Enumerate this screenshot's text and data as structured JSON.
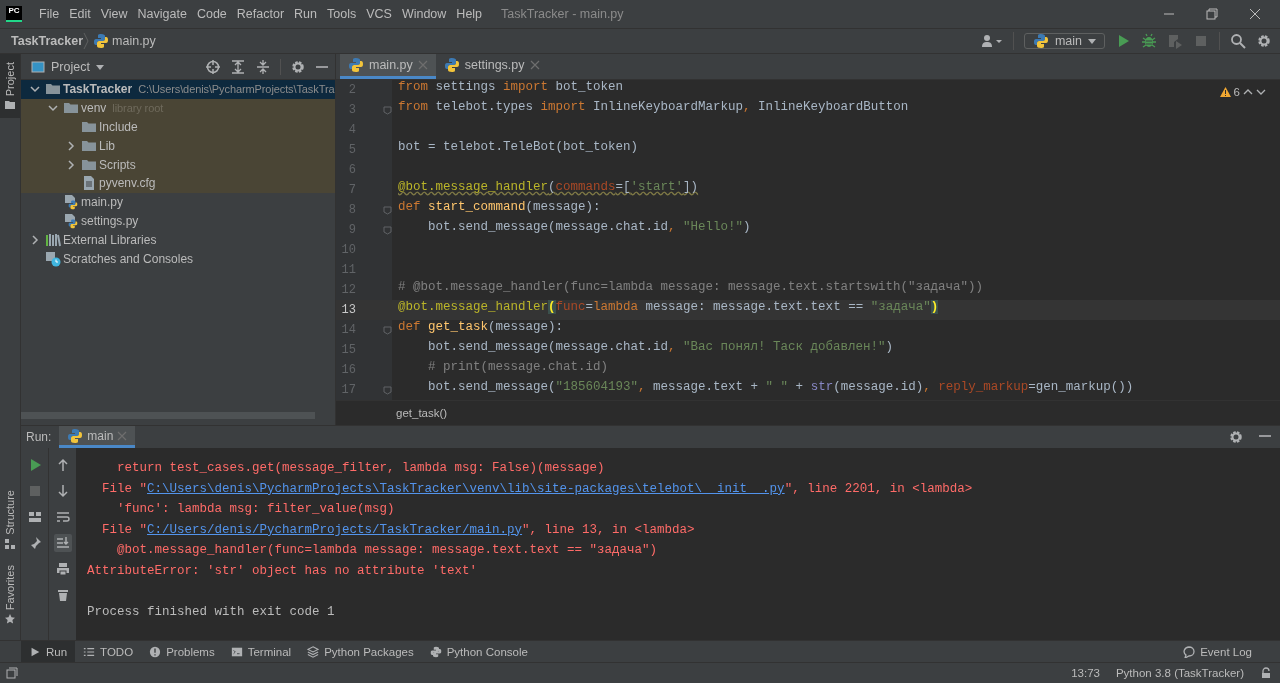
{
  "title_bar": {
    "logo": "PC",
    "menu": [
      "File",
      "Edit",
      "View",
      "Navigate",
      "Code",
      "Refactor",
      "Run",
      "Tools",
      "VCS",
      "Window",
      "Help"
    ],
    "title": "TaskTracker - main.py"
  },
  "navigation_bar": {
    "breadcrumbs": [
      "TaskTracker",
      "main.py"
    ],
    "run_configuration": "main"
  },
  "left_stripe": {
    "top_tabs": [
      {
        "label": "Project",
        "selected": true
      }
    ],
    "bottom_tabs": [
      {
        "label": "Structure",
        "selected": false
      },
      {
        "label": "Favorites",
        "selected": false
      }
    ]
  },
  "project_panel": {
    "title": "Project",
    "tree": [
      {
        "kind": "folder",
        "name": "TaskTracker",
        "hint": "C:\\Users\\denis\\PycharmProjects\\TaskTra",
        "expanded": true,
        "selected": true,
        "children": [
          {
            "kind": "folder",
            "name": "venv",
            "hint": "library root",
            "expanded": true,
            "selected": false,
            "library_root": true,
            "children": [
              {
                "kind": "folder",
                "name": "Include",
                "selected": false
              },
              {
                "kind": "folder",
                "name": "Lib",
                "expanded": false,
                "selected": false
              },
              {
                "kind": "folder",
                "name": "Scripts",
                "expanded": false,
                "selected": false
              },
              {
                "kind": "config",
                "name": "pyvenv.cfg",
                "selected": false
              }
            ]
          },
          {
            "kind": "python",
            "name": "main.py",
            "selected": false
          },
          {
            "kind": "python",
            "name": "settings.py",
            "selected": false
          }
        ]
      },
      {
        "kind": "libraries",
        "name": "External Libraries",
        "expanded": false,
        "selected": false
      },
      {
        "kind": "scratches",
        "name": "Scratches and Consoles",
        "selected": false
      }
    ]
  },
  "editor": {
    "tabs": [
      {
        "label": "main.py",
        "selected": true
      },
      {
        "label": "settings.py",
        "selected": false
      }
    ],
    "warnings": "6",
    "breadcrumb": "get_task()",
    "lines": [
      {
        "number": "2",
        "fold": false,
        "current": false,
        "tokens": [
          {
            "kind": "kw",
            "text": "from"
          },
          {
            "kind": "p",
            "text": " settings "
          },
          {
            "kind": "kw",
            "text": "import"
          },
          {
            "kind": "p",
            "text": " bot_token"
          }
        ]
      },
      {
        "number": "3",
        "fold": true,
        "current": false,
        "tokens": [
          {
            "kind": "kw",
            "text": "from"
          },
          {
            "kind": "p",
            "text": " telebot.types "
          },
          {
            "kind": "kw",
            "text": "import"
          },
          {
            "kind": "p",
            "text": " InlineKeyboardMarkup"
          },
          {
            "kind": "kw",
            "text": ", "
          },
          {
            "kind": "p",
            "text": "InlineKeyboardButton"
          }
        ]
      },
      {
        "number": "4",
        "fold": false,
        "current": false
      },
      {
        "number": "5",
        "fold": false,
        "current": false,
        "tokens": [
          {
            "kind": "p",
            "text": "bot = telebot.TeleBot(bot_token)"
          }
        ]
      },
      {
        "number": "6",
        "fold": false,
        "current": false
      },
      {
        "number": "7",
        "fold": false,
        "current": false,
        "warning": true,
        "tokens": [
          {
            "kind": "deco",
            "text": "@bot.message_handler"
          },
          {
            "kind": "p",
            "text": "("
          },
          {
            "kind": "param",
            "text": "commands"
          },
          {
            "kind": "p",
            "text": "=["
          },
          {
            "kind": "str",
            "text": "'start'"
          },
          {
            "kind": "p",
            "text": "])"
          }
        ]
      },
      {
        "number": "8",
        "fold": true,
        "current": false,
        "tokens": [
          {
            "kind": "kw",
            "text": "def "
          },
          {
            "kind": "fn",
            "text": "start_command"
          },
          {
            "kind": "p",
            "text": "(message):"
          }
        ]
      },
      {
        "number": "9",
        "fold": true,
        "current": false,
        "tokens": [
          {
            "kind": "p",
            "text": "    bot.send_message(message.chat.id"
          },
          {
            "kind": "kw",
            "text": ", "
          },
          {
            "kind": "str",
            "text": "\"Hello!\""
          },
          {
            "kind": "p",
            "text": ")"
          }
        ]
      },
      {
        "number": "10",
        "fold": false,
        "current": false
      },
      {
        "number": "11",
        "fold": false,
        "current": false
      },
      {
        "number": "12",
        "fold": false,
        "current": false,
        "tokens": [
          {
            "kind": "cm",
            "text": "# @bot.message_handler(func=lambda message: message.text.startswith(\"задача\"))"
          }
        ]
      },
      {
        "number": "13",
        "fold": false,
        "current": true,
        "tokens": [
          {
            "kind": "deco",
            "text": "@bot.message_handler"
          },
          {
            "kind": "match",
            "text": "("
          },
          {
            "kind": "param",
            "text": "func"
          },
          {
            "kind": "p",
            "text": "="
          },
          {
            "kind": "kw",
            "text": "lambda"
          },
          {
            "kind": "p",
            "text": " message: message.text.text == "
          },
          {
            "kind": "str",
            "text": "\"задача\""
          },
          {
            "kind": "match",
            "text": ")"
          }
        ]
      },
      {
        "number": "14",
        "fold": true,
        "current": false,
        "tokens": [
          {
            "kind": "kw",
            "text": "def "
          },
          {
            "kind": "fn",
            "text": "get_task"
          },
          {
            "kind": "p",
            "text": "(message):"
          }
        ]
      },
      {
        "number": "15",
        "fold": false,
        "current": false,
        "tokens": [
          {
            "kind": "p",
            "text": "    bot.send_message(message.chat.id"
          },
          {
            "kind": "kw",
            "text": ", "
          },
          {
            "kind": "str",
            "text": "\"Вас понял! Таск добавлен!\""
          },
          {
            "kind": "p",
            "text": ")"
          }
        ]
      },
      {
        "number": "16",
        "fold": false,
        "current": false,
        "tokens": [
          {
            "kind": "cm",
            "text": "    # print(message.chat.id)"
          }
        ]
      },
      {
        "number": "17",
        "fold": true,
        "current": false,
        "tokens": [
          {
            "kind": "p",
            "text": "    bot.send_message("
          },
          {
            "kind": "str",
            "text": "\"185604193\""
          },
          {
            "kind": "kw",
            "text": ", "
          },
          {
            "kind": "p",
            "text": "message.text + "
          },
          {
            "kind": "str",
            "text": "\" \""
          },
          {
            "kind": "p",
            "text": " + "
          },
          {
            "kind": "builtin",
            "text": "str"
          },
          {
            "kind": "p",
            "text": "(message.id)"
          },
          {
            "kind": "kw",
            "text": ", "
          },
          {
            "kind": "param",
            "text": "reply_markup"
          },
          {
            "kind": "p",
            "text": "=gen_markup())"
          }
        ]
      }
    ]
  },
  "run_panel": {
    "label": "Run:",
    "tabs": [
      {
        "label": "main",
        "selected": true
      }
    ],
    "console": [
      {
        "kind": "error",
        "segments": [
          {
            "kind": "text",
            "text": "    return test_cases.get(message_filter, lambda msg: False)(message)"
          }
        ]
      },
      {
        "kind": "error",
        "segments": [
          {
            "kind": "text",
            "text": "  File \""
          },
          {
            "kind": "link",
            "text": "C:\\Users\\denis\\PycharmProjects\\TaskTracker\\venv\\lib\\site-packages\\telebot\\__init__.py"
          },
          {
            "kind": "text",
            "text": "\", line 2201, in <lambda>"
          }
        ]
      },
      {
        "kind": "error",
        "segments": [
          {
            "kind": "text",
            "text": "    'func': lambda msg: filter_value(msg)"
          }
        ]
      },
      {
        "kind": "error",
        "segments": [
          {
            "kind": "text",
            "text": "  File \""
          },
          {
            "kind": "link",
            "text": "C:/Users/denis/PycharmProjects/TaskTracker/main.py"
          },
          {
            "kind": "text",
            "text": "\", line 13, in <lambda>"
          }
        ]
      },
      {
        "kind": "error",
        "segments": [
          {
            "kind": "text",
            "text": "    @bot.message_handler(func=lambda message: message.text.text == \"задача\")"
          }
        ]
      },
      {
        "kind": "error",
        "segments": [
          {
            "kind": "text",
            "text": "AttributeError: 'str' object has no attribute 'text'"
          }
        ]
      },
      {
        "kind": "output",
        "segments": [
          {
            "kind": "text",
            "text": "Process finished with exit code 1"
          }
        ]
      }
    ]
  },
  "tool_windows": [
    {
      "kind": "run",
      "label": "Run",
      "selected": true
    },
    {
      "kind": "todo",
      "label": "TODO",
      "selected": false
    },
    {
      "kind": "problems",
      "label": "Problems",
      "selected": false
    },
    {
      "kind": "terminal",
      "label": "Terminal",
      "selected": false
    },
    {
      "kind": "packages",
      "label": "Python Packages",
      "selected": false
    },
    {
      "kind": "console",
      "label": "Python Console",
      "selected": false
    }
  ],
  "event_log": "Event Log",
  "status_bar": {
    "caret": "13:73",
    "interpreter": "Python 3.8 (TaskTracker)"
  }
}
